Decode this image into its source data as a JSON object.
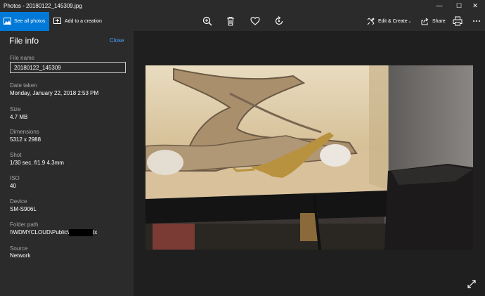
{
  "window": {
    "title": "Photos - 20180122_145309.jpg",
    "controls": [
      "minimize-icon",
      "maximize-icon",
      "close-icon"
    ]
  },
  "toolbar": {
    "see_all_label": "See all photos",
    "add_creation_label": "Add to a creation",
    "edit_create_label": "Edit & Create",
    "share_label": "Share",
    "icons": [
      "zoom-icon",
      "delete-icon",
      "favorite-icon",
      "rotate-icon",
      "edit-icon",
      "share-icon",
      "print-icon",
      "more-icon"
    ]
  },
  "file_info": {
    "title": "File info",
    "close_label": "Close",
    "file_name_label": "File name",
    "file_name_value": "20180122_145309",
    "date_taken_label": "Date taken",
    "date_taken_value": "Monday, January 22, 2018 2:53 PM",
    "size_label": "Size",
    "size_value": "4.7 MB",
    "dimensions_label": "Dimensions",
    "dimensions_value": "5312 x 2988",
    "shot_label": "Shot",
    "shot_value": "1/30 sec. f/1.9 4.3mm",
    "iso_label": "ISO",
    "iso_value": "40",
    "device_label": "Device",
    "device_value": "SM-S906L",
    "folder_path_label": "Folder path",
    "folder_path_prefix": "\\\\WDMYCLOUD\\Public\\",
    "folder_path_suffix": "tx",
    "source_label": "Source",
    "source_value": "Network"
  },
  "colors": {
    "accent": "#0078d7",
    "link": "#4aa3ff",
    "panel": "#2b2b2b",
    "background": "#1f1f1f"
  }
}
